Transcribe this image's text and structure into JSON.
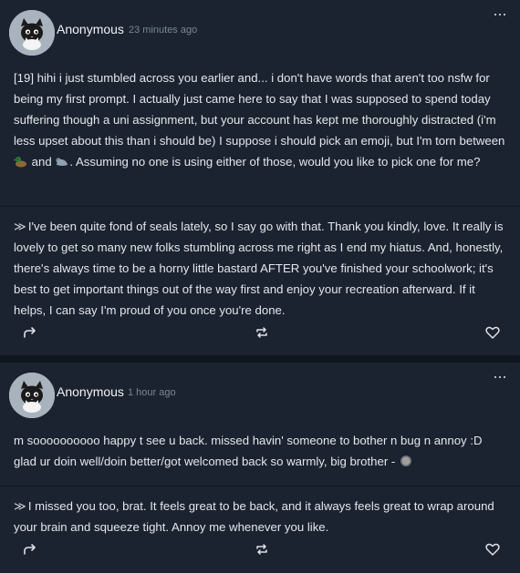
{
  "posts": [
    {
      "author": "Anonymous",
      "time": "23 minutes ago",
      "ask": "[19] hihi i just stumbled across you earlier and... i don't have words that aren't too nsfw for being my first prompt. I actually just came here to say that I was supposed to spend today suffering though a uni assignment, but your account has kept me thoroughly distracted (i'm less upset about this than i should be) I suppose i should pick an emoji, but I'm torn between",
      "ask_mid": "and",
      "ask_end": ". Assuming no one is using either of those, would you like to pick one for me?",
      "emoji1": "duck-emoji",
      "emoji2": "seal-emoji",
      "answer": "I've been quite fond of seals lately, so I say go with that. Thank you kindly, love. It really is lovely to get so many new folks stumbling across me right as I end my hiatus. And, honestly, there's always time to be a horny little bastard AFTER you've finished your schoolwork; it's best to get important things out of the way first and enjoy your recreation afterward. If it helps, I can say I'm proud of you once you're done.",
      "chevron": "≫"
    },
    {
      "author": "Anonymous",
      "time": "1 hour ago",
      "ask": "m soooooooooo happy t see u back. missed havin' someone to bother n bug n annoy :D glad ur doin well/doin better/got welcomed back so warmly, big brother -",
      "emoji": "cookie-emoji",
      "answer": "I missed you too, brat. It feels great to be back, and it always feels great to wrap around your brain and squeeze tight. Annoy me whenever you like.",
      "chevron": "≫"
    }
  ],
  "colors": {
    "background": "#0f1620",
    "card": "#1b2230",
    "text": "#e4e8ec",
    "muted": "#7a8896"
  },
  "icons": [
    "share-icon",
    "reblog-icon",
    "heart-icon",
    "more-options-icon"
  ]
}
